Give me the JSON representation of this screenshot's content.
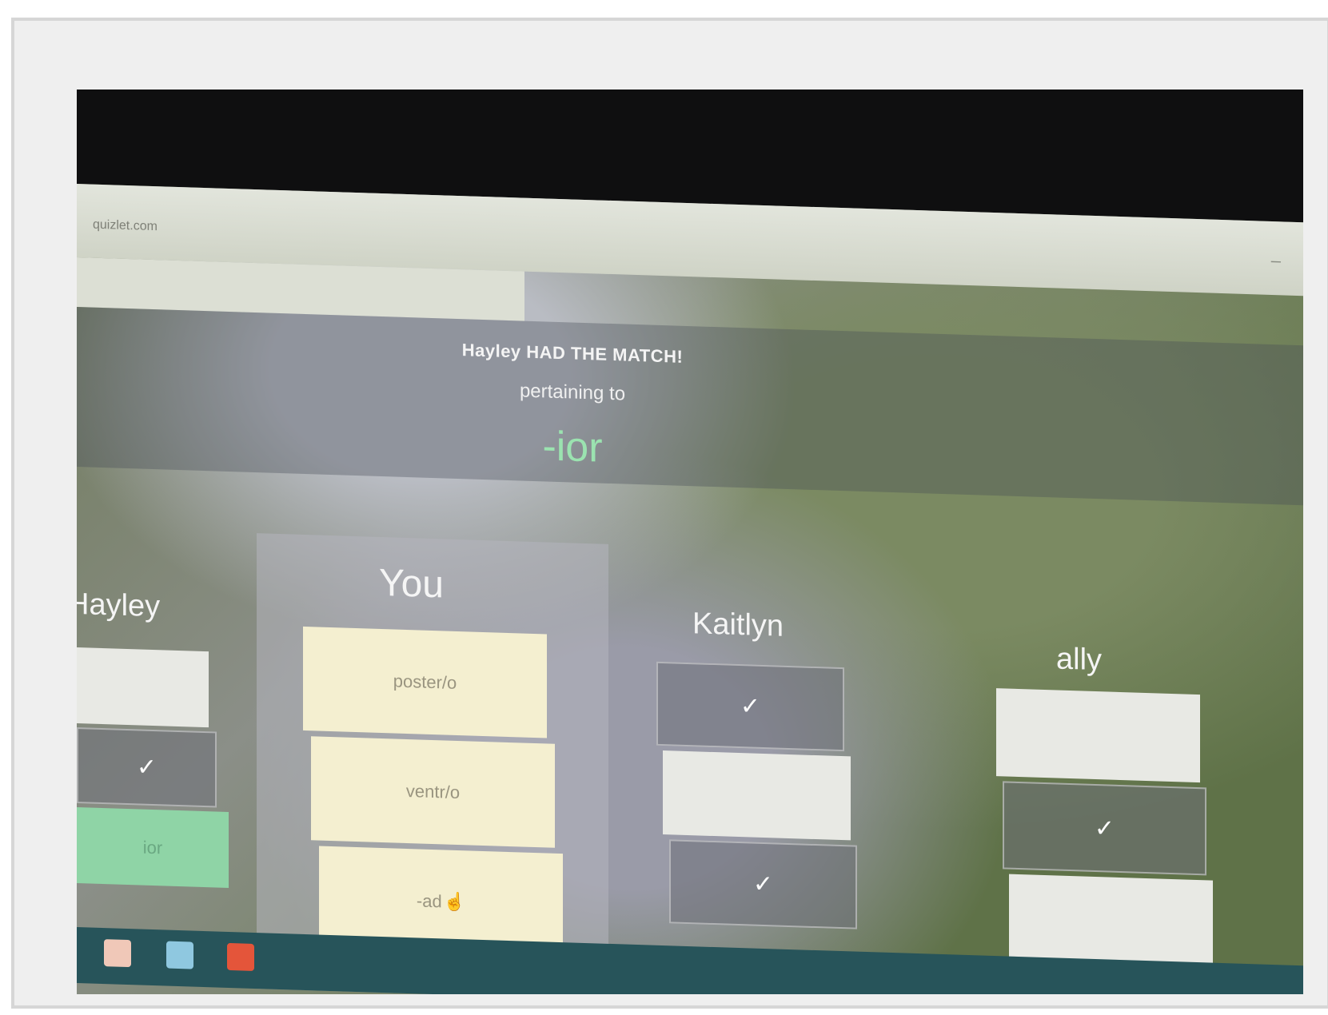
{
  "browser": {
    "url": "quizlet.com",
    "minimize_glyph": "–"
  },
  "match": {
    "announcement": "Hayley HAD THE MATCH!",
    "pertaining": "pertaining to",
    "term": "-ior"
  },
  "players": [
    {
      "name": "Hayley",
      "tiles": [
        {
          "state": "empty"
        },
        {
          "state": "done",
          "icon": "checkmark-icon"
        },
        {
          "state": "matched",
          "label": "ior"
        }
      ]
    },
    {
      "name": "You",
      "tiles": [
        {
          "state": "option",
          "label": "poster/o"
        },
        {
          "state": "option",
          "label": "ventr/o"
        },
        {
          "state": "option",
          "label": "-ad"
        }
      ]
    },
    {
      "name": "Kaitlyn",
      "tiles": [
        {
          "state": "done",
          "icon": "checkmark-icon"
        },
        {
          "state": "empty"
        },
        {
          "state": "done",
          "icon": "checkmark-icon"
        }
      ]
    },
    {
      "name": "ally",
      "tiles": [
        {
          "state": "empty"
        },
        {
          "state": "done",
          "icon": "checkmark-icon"
        },
        {
          "state": "empty"
        }
      ]
    }
  ],
  "check_glyph": "✓",
  "taskbar": {
    "icons": [
      "mail-icon",
      "document-icon",
      "video-icon"
    ]
  },
  "colors": {
    "accent_term": "#9be3b0",
    "tile_option": "#f4efd0",
    "tile_matched": "#8fd4a6",
    "taskbar": "#27545a"
  }
}
